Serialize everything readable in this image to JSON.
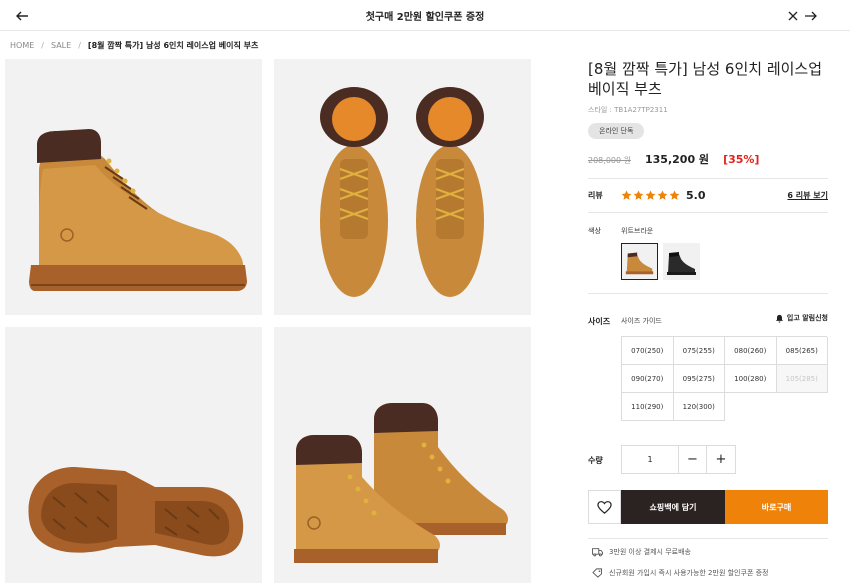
{
  "topbar": {
    "title": "첫구매 2만원 할인쿠폰 증정"
  },
  "breadcrumb": {
    "home": "HOME",
    "sale": "SALE",
    "current": "[8월 깜짝 특가] 남성 6인치 레이스업 베이직 부츠",
    "separator": "/"
  },
  "product": {
    "title": "[8월 깜짝 특가] 남성 6인치 레이스업 베이직 부츠",
    "style_code": "스타일 : TB1A27TP2311",
    "badge": "온라인 단독",
    "original_price": "208,000 원",
    "sale_price": "135,200 원",
    "discount": "[35%]",
    "review_label": "리뷰",
    "rating": "5.0",
    "rating_value": 5,
    "review_link": "6 리뷰 보기",
    "color_label": "색상",
    "color_name": "위트브라운",
    "size_label": "사이즈",
    "size_guide": "사이즈 가이드",
    "restock_alert": "입고 알림신청",
    "sizes": [
      {
        "label": "070(250)",
        "soldout": false
      },
      {
        "label": "075(255)",
        "soldout": false
      },
      {
        "label": "080(260)",
        "soldout": false
      },
      {
        "label": "085(265)",
        "soldout": false
      },
      {
        "label": "090(270)",
        "soldout": false
      },
      {
        "label": "095(275)",
        "soldout": false
      },
      {
        "label": "100(280)",
        "soldout": false
      },
      {
        "label": "105(285)",
        "soldout": true
      },
      {
        "label": "110(290)",
        "soldout": false
      },
      {
        "label": "120(300)",
        "soldout": false
      }
    ],
    "quantity_label": "수량",
    "quantity": "1",
    "minus": "−",
    "plus": "+",
    "cart_button": "쇼핑백에 담기",
    "buy_button": "바로구매"
  },
  "benefits": {
    "shipping": "3만원 이상 결제시 무료배송",
    "coupon": "신규회원 가입시 즉시 사용가능한 2만원 할인쿠폰 증정"
  },
  "colors": {
    "accent": "#ef8208",
    "cart": "#2b2321",
    "discount": "#e2231a",
    "star": "#ef8208",
    "leather": "#c78a3a",
    "collar": "#4a2c22"
  }
}
